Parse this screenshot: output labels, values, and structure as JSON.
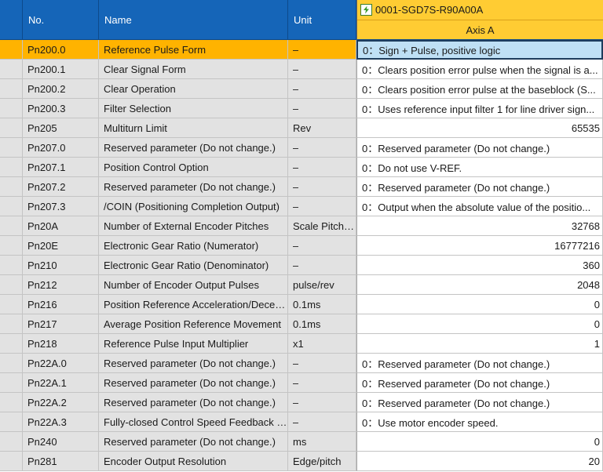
{
  "header": {
    "no": "No.",
    "name": "Name",
    "unit": "Unit",
    "device": "0001-SGD7S-R90A00A",
    "axis": "Axis A"
  },
  "rows": [
    {
      "no": "Pn200.0",
      "name": "Reference Pulse Form",
      "unit": "–",
      "value": "0：Sign + Pulse, positive logic",
      "numeric": false,
      "selected": true
    },
    {
      "no": "Pn200.1",
      "name": "Clear Signal Form",
      "unit": "–",
      "value": "0：Clears position error pulse when the signal is a...",
      "numeric": false
    },
    {
      "no": "Pn200.2",
      "name": "Clear Operation",
      "unit": "–",
      "value": "0：Clears position error pulse at the baseblock (S...",
      "numeric": false
    },
    {
      "no": "Pn200.3",
      "name": "Filter Selection",
      "unit": "–",
      "value": "0：Uses reference input filter 1 for line driver sign...",
      "numeric": false
    },
    {
      "no": "Pn205",
      "name": "Multiturn Limit",
      "unit": "Rev",
      "value": "65535",
      "numeric": true
    },
    {
      "no": "Pn207.0",
      "name": "Reserved parameter (Do not change.)",
      "unit": "–",
      "value": "0：Reserved parameter (Do not change.)",
      "numeric": false
    },
    {
      "no": "Pn207.1",
      "name": "Position Control Option",
      "unit": "–",
      "value": "0：Do not use V-REF.",
      "numeric": false
    },
    {
      "no": "Pn207.2",
      "name": "Reserved parameter (Do not change.)",
      "unit": "–",
      "value": "0：Reserved parameter (Do not change.)",
      "numeric": false
    },
    {
      "no": "Pn207.3",
      "name": "/COIN (Positioning Completion Output)",
      "unit": "–",
      "value": "0：Output when the absolute value of the positio...",
      "numeric": false
    },
    {
      "no": "Pn20A",
      "name": "Number of External Encoder Pitches",
      "unit": "Scale Pitch/Rev",
      "value": "32768",
      "numeric": true
    },
    {
      "no": "Pn20E",
      "name": "Electronic Gear Ratio (Numerator)",
      "unit": "–",
      "value": "16777216",
      "numeric": true
    },
    {
      "no": "Pn210",
      "name": "Electronic Gear Ratio (Denominator)",
      "unit": "–",
      "value": "360",
      "numeric": true
    },
    {
      "no": "Pn212",
      "name": "Number of Encoder Output Pulses",
      "unit": "pulse/rev",
      "value": "2048",
      "numeric": true
    },
    {
      "no": "Pn216",
      "name": "Position Reference Acceleration/Deceleration",
      "unit": "0.1ms",
      "value": "0",
      "numeric": true
    },
    {
      "no": "Pn217",
      "name": "Average Position Reference Movement",
      "unit": "0.1ms",
      "value": "0",
      "numeric": true
    },
    {
      "no": "Pn218",
      "name": "Reference Pulse Input Multiplier",
      "unit": "x1",
      "value": "1",
      "numeric": true
    },
    {
      "no": "Pn22A.0",
      "name": "Reserved parameter (Do not change.)",
      "unit": "–",
      "value": "0：Reserved parameter (Do not change.)",
      "numeric": false
    },
    {
      "no": "Pn22A.1",
      "name": "Reserved parameter (Do not change.)",
      "unit": "–",
      "value": "0：Reserved parameter (Do not change.)",
      "numeric": false
    },
    {
      "no": "Pn22A.2",
      "name": "Reserved parameter (Do not change.)",
      "unit": "–",
      "value": "0：Reserved parameter (Do not change.)",
      "numeric": false
    },
    {
      "no": "Pn22A.3",
      "name": "Fully-closed Control Speed Feedback Selection",
      "unit": "–",
      "value": "0：Use motor encoder speed.",
      "numeric": false
    },
    {
      "no": "Pn240",
      "name": "Reserved parameter (Do not change.)",
      "unit": "ms",
      "value": "0",
      "numeric": true
    },
    {
      "no": "Pn281",
      "name": "Encoder Output Resolution",
      "unit": "Edge/pitch",
      "value": "20",
      "numeric": true
    }
  ]
}
